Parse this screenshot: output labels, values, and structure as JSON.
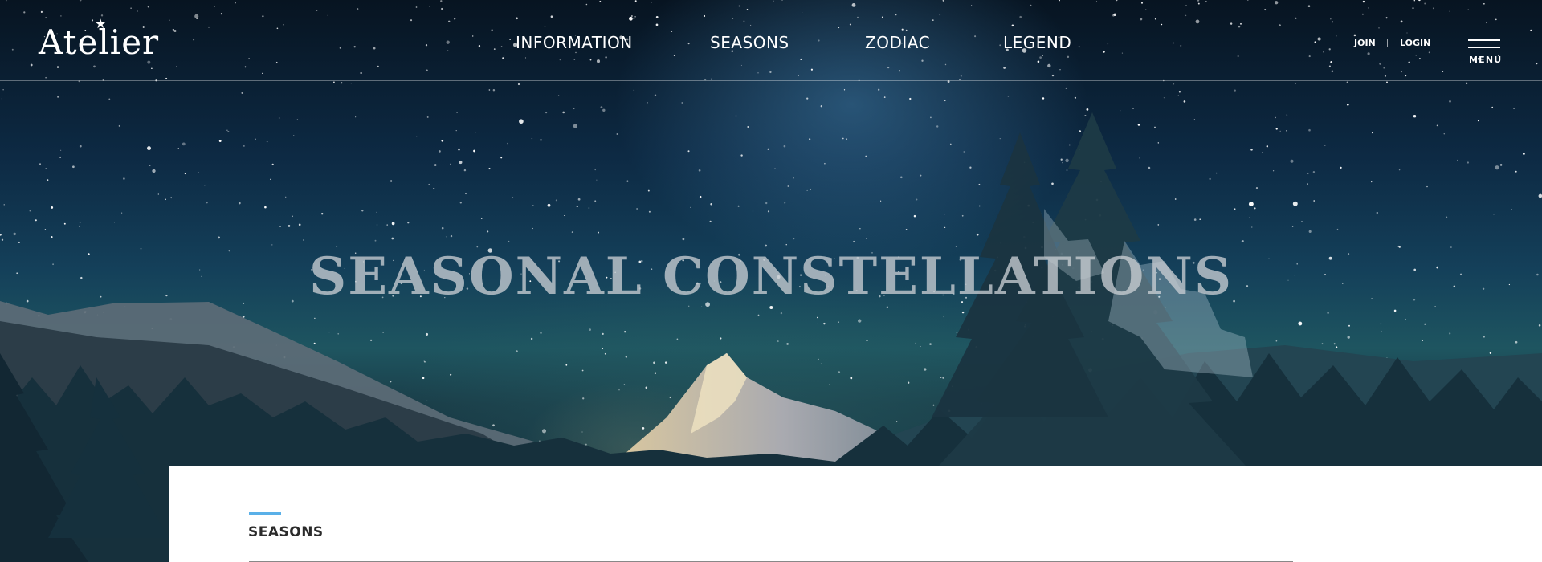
{
  "header": {
    "logo_text": "Atelier",
    "nav": [
      {
        "label": "INFORMATION"
      },
      {
        "label": "SEASONS"
      },
      {
        "label": "ZODIAC"
      },
      {
        "label": "LEGEND"
      }
    ],
    "auth": {
      "join": "JOIN",
      "login": "LOGIN"
    },
    "menu_label": "MENU"
  },
  "hero": {
    "title": "SEASONAL CONSTELLATIONS",
    "background": "starry-night-mountain-forest"
  },
  "content": {
    "section_title": "SEASONS"
  },
  "colors": {
    "accent": "#5ab0e8",
    "title_text": "#2b2b2b",
    "nav_text": "#ffffff"
  }
}
